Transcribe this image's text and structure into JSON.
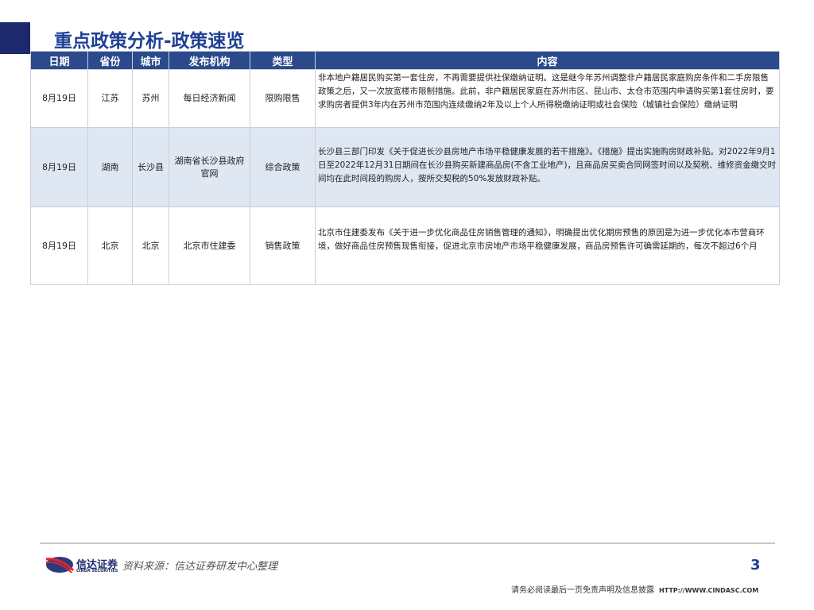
{
  "title": "重点政策分析-政策速览",
  "table": {
    "headers": [
      "日期",
      "省份",
      "城市",
      "发布机构",
      "类型",
      "内容"
    ],
    "rows": [
      {
        "date": "8月19日",
        "province": "江苏",
        "city": "苏州",
        "agency": "每日经济新闻",
        "type": "限购限售",
        "content": "非本地户籍居民购买第一套住房，不再需要提供社保缴纳证明。这是继今年苏州调整非户籍居民家庭购房条件和二手房限售政策之后，又一次放宽楼市限制措施。此前，非户籍居民家庭在苏州市区、昆山市、太仓市范围内申请购买第1套住房时，要求购房者提供3年内在苏州市范围内连续缴纳2年及以上个人所得税缴纳证明或社会保险（城镇社会保险）缴纳证明"
      },
      {
        "date": "8月19日",
        "province": "湖南",
        "city": "长沙县",
        "agency": "湖南省长沙县政府官网",
        "type": "综合政策",
        "content": "长沙县三部门印发《关于促进长沙县房地产市场平稳健康发展的若干措施》。《措施》提出实施购房财政补贴。对2022年9月1日至2022年12月31日期间在长沙县购买新建商品房(不含工业地产)，且商品房买卖合同网签时间以及契税、维修资金缴交时间均在此时间段的购房人，按所交契税的50%发放财政补贴。"
      },
      {
        "date": "8月19日",
        "province": "北京",
        "city": "北京",
        "agency": "北京市住建委",
        "type": "销售政策",
        "content": "北京市住建委发布《关于进一步优化商品住房销售管理的通知》，明确提出优化期房预售的原因是为进一步优化本市营商环境，做好商品住房预售现售衔接，促进北京市房地产市场平稳健康发展，商品房预售许可确需延期的，每次不超过6个月"
      }
    ]
  },
  "footer": {
    "brand": "信达证券",
    "brand_en": "CINDA SECURITIES",
    "source": "资料来源：信达证券研发中心整理",
    "page": "3",
    "disclaimer": "请务必阅读最后一页免责声明及信息披露",
    "url": "HTTP://WWW.CINDASC.COM"
  }
}
